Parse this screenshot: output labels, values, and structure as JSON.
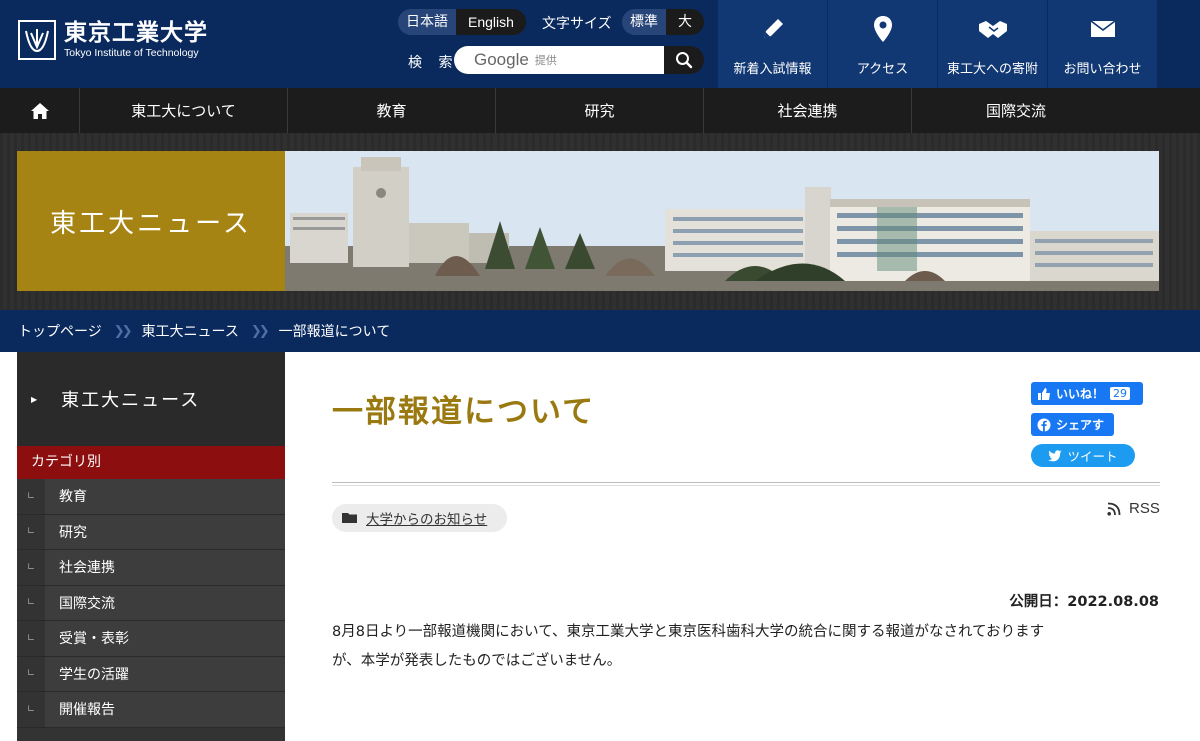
{
  "header": {
    "logo_title": "東京工業大学",
    "logo_sub": "Tokyo Institute of Technology",
    "lang_ja": "日本語",
    "lang_en": "English",
    "fontsize_label": "文字サイズ",
    "fontsize_std": "標準",
    "fontsize_big": "大",
    "search_label": "検 索",
    "search_google": "Google",
    "search_provided": "提供",
    "buttons": [
      {
        "label": "新着入試情報",
        "icon": "pencil-icon"
      },
      {
        "label": "アクセス",
        "icon": "map-pin-icon"
      },
      {
        "label": "東工大への寄附",
        "icon": "handshake-icon"
      },
      {
        "label": "お問い合わせ",
        "icon": "envelope-icon"
      }
    ]
  },
  "nav": {
    "items": [
      "東工大について",
      "教育",
      "研究",
      "社会連携",
      "国際交流"
    ]
  },
  "banner": {
    "title": "東工大ニュース"
  },
  "breadcrumb": {
    "items": [
      "トップページ",
      "東工大ニュース",
      "一部報道について"
    ],
    "separator": "》"
  },
  "sidebar": {
    "heading": "東工大ニュース",
    "category_header": "カテゴリ別",
    "items": [
      "教育",
      "研究",
      "社会連携",
      "国際交流",
      "受賞・表彰",
      "学生の活躍",
      "開催報告"
    ]
  },
  "article": {
    "title": "一部報道について",
    "category": "大学からのお知らせ",
    "rss": "RSS",
    "date": "公開日：2022.08.08",
    "body_line1": "8月8日より一部報道機関において、東京工業大学と東京医科歯科大学の統合に関する報道がなされております",
    "body_line2": "が、本学が発表したものではございません。"
  },
  "social": {
    "like_label": "いいね！",
    "like_count": "29",
    "share_label": "シェアす",
    "tweet_label": "ツイート"
  },
  "colors": {
    "header_blue": "#0a2a5e",
    "title_gold": "#9a7a10",
    "banner_gold": "#a68414",
    "category_red": "#8c0e0e"
  }
}
